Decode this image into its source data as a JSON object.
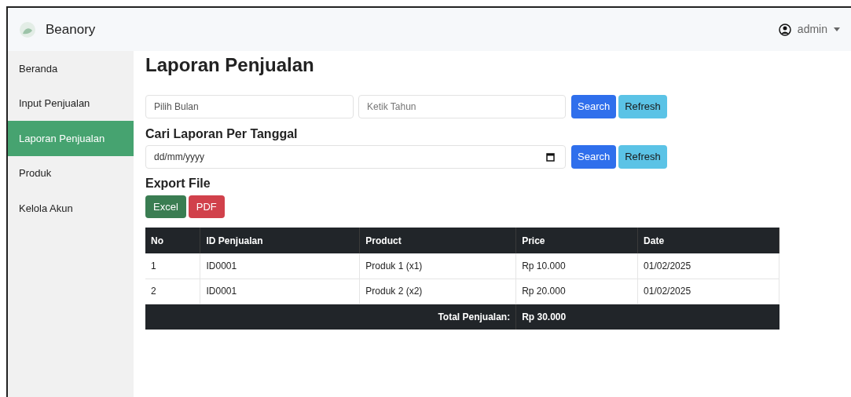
{
  "navbar": {
    "brand": "Beanory",
    "user": "admin"
  },
  "sidebar": {
    "items": [
      {
        "label": "Beranda",
        "selected": false
      },
      {
        "label": "Input Penjualan",
        "selected": false
      },
      {
        "label": "Laporan Penjualan",
        "selected": true
      },
      {
        "label": "Produk",
        "selected": false
      },
      {
        "label": "Kelola Akun",
        "selected": false
      }
    ]
  },
  "page_title": "Laporan Penjualan",
  "month_filter": {
    "month_placeholder": "Pilih Bulan",
    "year_placeholder": "Ketik Tahun",
    "search": "Search",
    "refresh": "Refresh"
  },
  "date_filter": {
    "heading": "Cari Laporan Per Tanggal",
    "placeholder": "dd/mm/yyyy",
    "search": "Search",
    "refresh": "Refresh"
  },
  "export": {
    "heading": "Export File",
    "buttons": [
      {
        "label": "Excel",
        "kind": "excel"
      },
      {
        "label": "PDF",
        "kind": "pdf"
      }
    ]
  },
  "table": {
    "columns": [
      "No",
      "ID Penjualan",
      "Product",
      "Price",
      "Date"
    ],
    "rows": [
      [
        "1",
        "ID0001",
        "Produk 1 (x1)",
        "Rp 10.000",
        "01/02/2025"
      ],
      [
        "2",
        "ID0001",
        "Produk 2 (x2)",
        "Rp 20.000",
        "01/02/2025"
      ]
    ],
    "footer": {
      "label": "Total Penjualan:",
      "value": "Rp 30.000"
    }
  }
}
